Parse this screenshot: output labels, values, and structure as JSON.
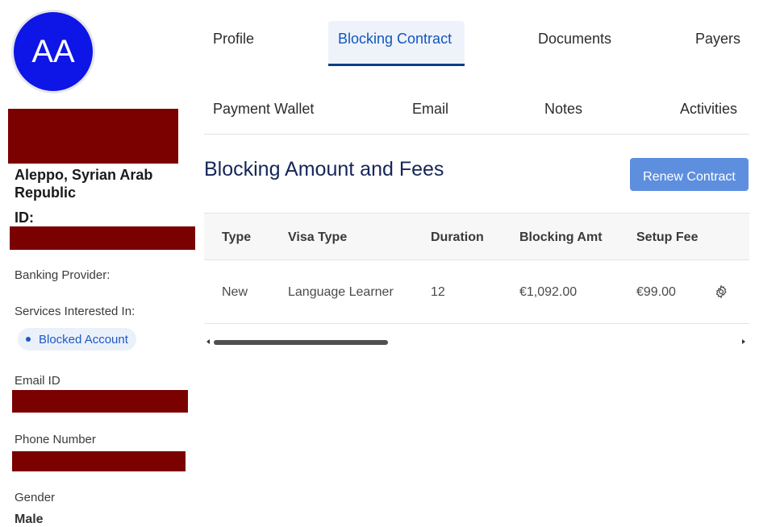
{
  "profile": {
    "avatar_initials": "AA",
    "location": "Aleppo, Syrian Arab Republic",
    "id_label": "ID:",
    "banking_provider_label": "Banking Provider:",
    "services_label": "Services Interested In:",
    "services": [
      "Blocked Account"
    ],
    "email_label": "Email ID",
    "phone_label": "Phone Number",
    "gender_label": "Gender",
    "gender_value": "Male"
  },
  "tabs": {
    "row1": [
      "Profile",
      "Blocking Contract",
      "Documents",
      "Payers"
    ],
    "row2": [
      "Payment Wallet",
      "Email",
      "Notes",
      "Activities"
    ],
    "active": "Blocking Contract"
  },
  "section": {
    "title": "Blocking Amount and Fees",
    "renew_button": "Renew Contract"
  },
  "table": {
    "headers": [
      "Type",
      "Visa Type",
      "Duration",
      "Blocking Amt",
      "Setup Fee"
    ],
    "rows": [
      {
        "type": "New",
        "visa_type": "Language Learner",
        "duration": "12",
        "blocking_amt": "€1,092.00",
        "setup_fee": "€99.00",
        "action_icon": "gear-icon"
      }
    ]
  },
  "colors": {
    "avatar": "#0d16e6",
    "redaction": "#7b0000",
    "accent": "#1256bf",
    "button": "#5e8fdf",
    "title": "#162659"
  }
}
